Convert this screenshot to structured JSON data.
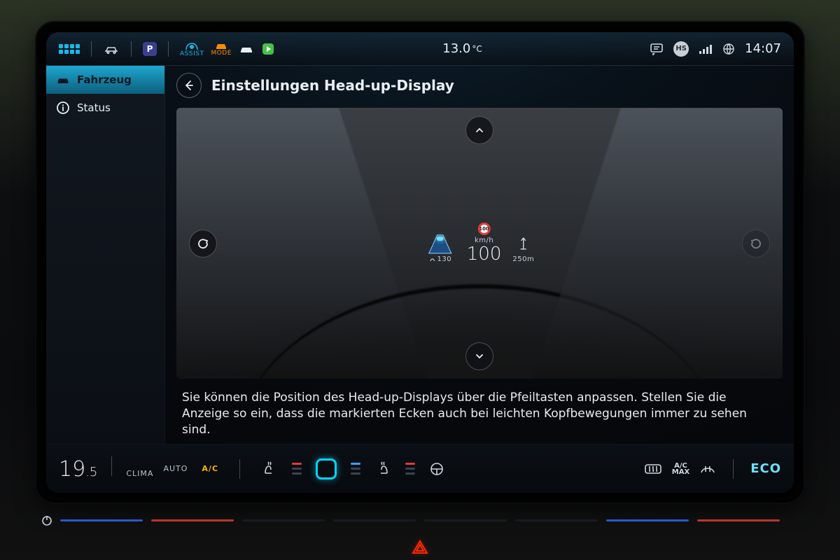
{
  "topbar": {
    "assist_label": "ASSIST",
    "mode_label": "MODE",
    "parking_chip": "P",
    "temperature_value": "13.0",
    "temperature_unit": "°C",
    "profile_initials": "HS",
    "clock": "14:07"
  },
  "sidebar": {
    "items": [
      {
        "label": "Fahrzeug",
        "active": true
      },
      {
        "label": "Status",
        "active": false
      }
    ]
  },
  "page": {
    "title": "Einstellungen Head-up-Display",
    "help_text": "Sie können die Position des Head-up-Displays über die Pfeiltasten anpassen. Stellen Sie die Anzeige so ein, dass die markierten Ecken auch bei leichten Kopfbewegungen immer zu sehen sind."
  },
  "hud": {
    "lane_distance": "130",
    "speed_limit": "100",
    "speed_unit": "km/h",
    "speed_value": "100",
    "next_distance": "250m"
  },
  "climate": {
    "temp_whole": "19",
    "temp_frac": ".5",
    "label_clima": "CLIMA",
    "label_auto": "AUTO",
    "label_ac": "A/C",
    "ac_max_line1": "A/C",
    "ac_max_line2": "MAX",
    "eco_label": "ECO"
  }
}
